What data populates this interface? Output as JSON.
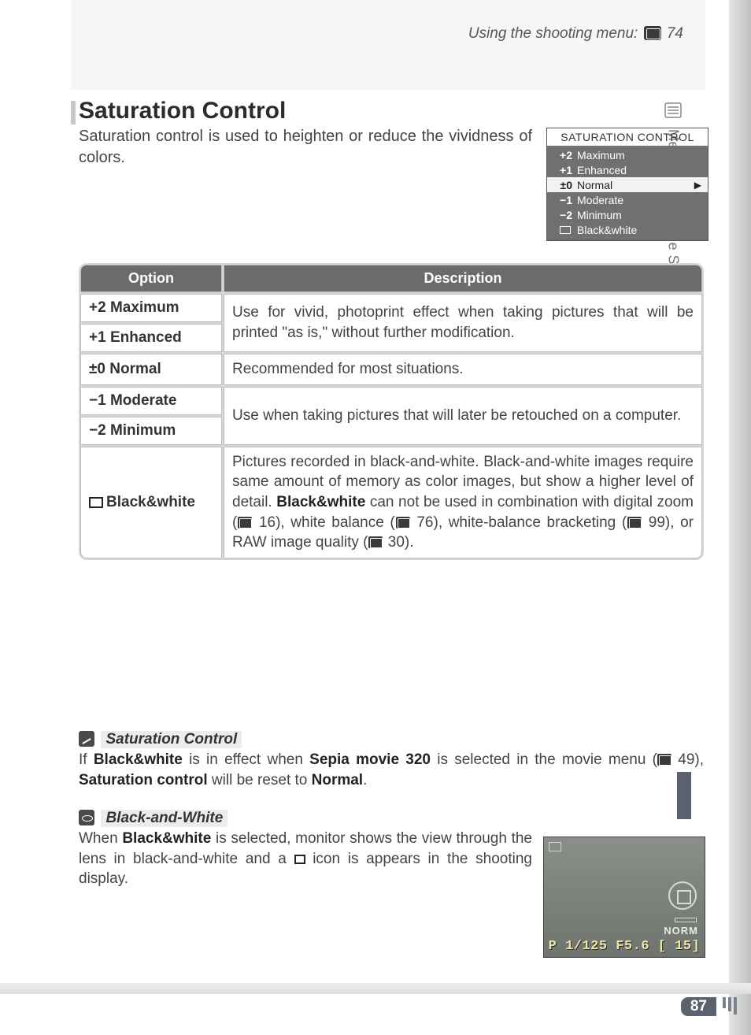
{
  "header": {
    "breadcrumb_text": "Using the shooting menu:",
    "breadcrumb_ref": "74"
  },
  "side": {
    "label": "Menu Guide—The Shooting Menu"
  },
  "title": "Saturation Control",
  "intro": "Saturation control is used to heighten or reduce the vividness of colors.",
  "menubox": {
    "title": "SATURATION CONTROL",
    "rows": [
      {
        "key": "+2",
        "val": "Maximum",
        "selected": false,
        "bw": false
      },
      {
        "key": "+1",
        "val": "Enhanced",
        "selected": false,
        "bw": false
      },
      {
        "key": "±0",
        "val": "Normal",
        "selected": true,
        "bw": false
      },
      {
        "key": "−1",
        "val": "Moderate",
        "selected": false,
        "bw": false
      },
      {
        "key": "−2",
        "val": "Minimum",
        "selected": false,
        "bw": false
      },
      {
        "key": "",
        "val": "Black&white",
        "selected": false,
        "bw": true
      }
    ]
  },
  "table": {
    "head_option": "Option",
    "head_desc": "Description",
    "r1a": "+2 Maximum",
    "r1b": "+1 Enhanced",
    "r1desc_a": "Use for vivid, photoprint effect when taking pictures that will be printed \"as is,\" without further modification.",
    "r2a": "±0 Normal",
    "r2desc": "Recommended for most situations.",
    "r3a": "−1 Moderate",
    "r3b": "−2 Minimum",
    "r3desc": "Use when taking pictures that will later be retouched on a computer.",
    "r4a": "Black&white",
    "r4desc_pre": "Pictures recorded in black-and-white.  Black-and-white images require same amount of memory as color images, but show a higher level of detail.  ",
    "r4desc_bold": "Black&white",
    "r4desc_post1": " can not be used in combination with digital zoom (",
    "r4ref1": "16",
    "r4desc_post2": "), white balance (",
    "r4ref2": "76",
    "r4desc_post3": "), white-balance bracketing (",
    "r4ref3": "99",
    "r4desc_post4": "), or RAW image quality (",
    "r4ref4": "30",
    "r4desc_post5": ")."
  },
  "note1": {
    "head": "Saturation Control",
    "t1": "If ",
    "b1": "Black&white",
    "t2": " is in effect when ",
    "b2": "Sepia movie 320",
    "t3": " is selected in the movie menu (",
    "ref": "49",
    "t4": "), ",
    "b3": "Saturation control",
    "t5": " will be reset to ",
    "b4": "Normal",
    "t6": "."
  },
  "note2": {
    "head": "Black-and-White",
    "t1": "When ",
    "b1": "Black&white",
    "t2": " is selected, monitor shows the view through the lens in black-and-white and a ",
    "t3": " icon is appears in the shooting display."
  },
  "lcd": {
    "norm": "NORM",
    "status": "P  1/125  F5.6  [   15]"
  },
  "page_number": "87"
}
